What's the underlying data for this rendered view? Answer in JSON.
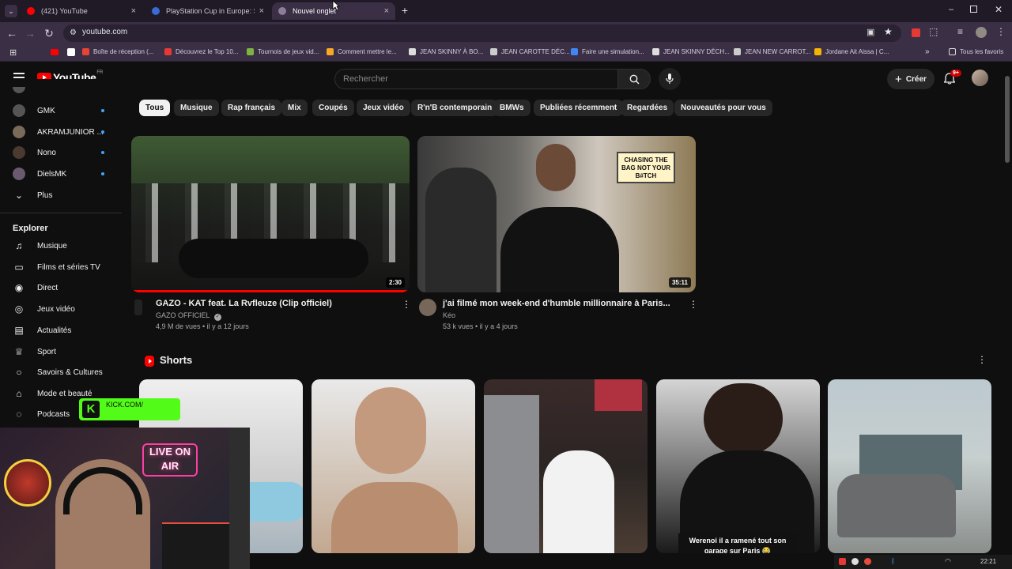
{
  "browser": {
    "tabs": [
      {
        "title": "(421) YouTube",
        "favicon_color": "#ff0000",
        "active": false
      },
      {
        "title": "PlayStation Cup in Europe: Ses",
        "favicon_color": "#3a6ad4",
        "active": false
      },
      {
        "title": "Nouvel onglet",
        "favicon_color": "#8a7f96",
        "active": true
      }
    ],
    "url": "youtube.com",
    "bookmarks": [
      {
        "label": "Boîte de réception (...",
        "color": "#ea4335"
      },
      {
        "label": "Découvrez le Top 10...",
        "color": "#e53935"
      },
      {
        "label": "Tournois de jeux vid...",
        "color": "#7cb342"
      },
      {
        "label": "Comment mettre le...",
        "color": "#f9a825"
      },
      {
        "label": "JEAN SKINNY À BO...",
        "color": "#dddddd"
      },
      {
        "label": "JEAN CAROTTE DÉC...",
        "color": "#cccccc"
      },
      {
        "label": "Faire une simulation...",
        "color": "#4285f4"
      },
      {
        "label": "JEAN SKINNY DÉCH...",
        "color": "#dddddd"
      },
      {
        "label": "JEAN NEW CARROT...",
        "color": "#cccccc"
      },
      {
        "label": "Jordane Ait Aissa | C...",
        "color": "#f4b400"
      }
    ],
    "all_bookmarks": "Tous les favoris"
  },
  "youtube": {
    "logo": "YouTube",
    "region": "FR",
    "search_placeholder": "Rechercher",
    "create_label": "Créer",
    "notif_badge": "9+",
    "chips": [
      "Tous",
      "Musique",
      "Rap français",
      "Mix",
      "Coupés",
      "Jeux vidéo",
      "R'n'B contemporain",
      "BMWs",
      "Publiées récemment",
      "Regardées",
      "Nouveautés pour vous"
    ],
    "subscriptions": [
      {
        "name": "GMK",
        "color": "#555"
      },
      {
        "name": "AKRAMJUNIOR ...",
        "color": "#7a6a5a"
      },
      {
        "name": "Nono",
        "color": "#4a3a30"
      },
      {
        "name": "DielsMK",
        "color": "#6a5a70"
      }
    ],
    "more_label": "Plus",
    "explore_heading": "Explorer",
    "explore_items": [
      {
        "label": "Musique",
        "icon": "music-note-icon",
        "glyph": "♫"
      },
      {
        "label": "Films et séries TV",
        "icon": "film-icon",
        "glyph": "▭"
      },
      {
        "label": "Direct",
        "icon": "live-icon",
        "glyph": "◉"
      },
      {
        "label": "Jeux vidéo",
        "icon": "gamepad-icon",
        "glyph": "◎"
      },
      {
        "label": "Actualités",
        "icon": "news-icon",
        "glyph": "▤"
      },
      {
        "label": "Sport",
        "icon": "trophy-icon",
        "glyph": "♕"
      },
      {
        "label": "Savoirs & Cultures",
        "icon": "lightbulb-icon",
        "glyph": "○"
      },
      {
        "label": "Mode et beauté",
        "icon": "hanger-icon",
        "glyph": "⌂"
      },
      {
        "label": "Podcasts",
        "icon": "podcast-icon",
        "glyph": "◌"
      }
    ],
    "videos": [
      {
        "title": "GAZO - KAT feat. La Rvfleuze (Clip officiel)",
        "channel": "GAZO OFFICIEL",
        "verified": "✓",
        "meta": "4,9 M de vues • il y a 12 jours",
        "duration": "2:30"
      },
      {
        "title": "j'ai filmé mon week-end d'humble millionnaire à Paris...",
        "channel": "Kéo",
        "meta": "53 k vues • il y a 4 jours",
        "duration": "35:11",
        "sign_text": "CHASING THE BAG NOT YOUR B#TCH"
      }
    ],
    "shorts_heading": "Shorts",
    "shorts": [
      {
        "caption": ""
      },
      {
        "caption": ""
      },
      {
        "caption": ""
      },
      {
        "caption": "Werenoi il a ramené tout son garage sur Paris 😂"
      },
      {
        "caption": ""
      }
    ]
  },
  "overlay": {
    "kick_label": "KICK.COM/",
    "neon_sign": "LIVE ON AIR"
  },
  "taskbar": {
    "time": "22:21"
  }
}
